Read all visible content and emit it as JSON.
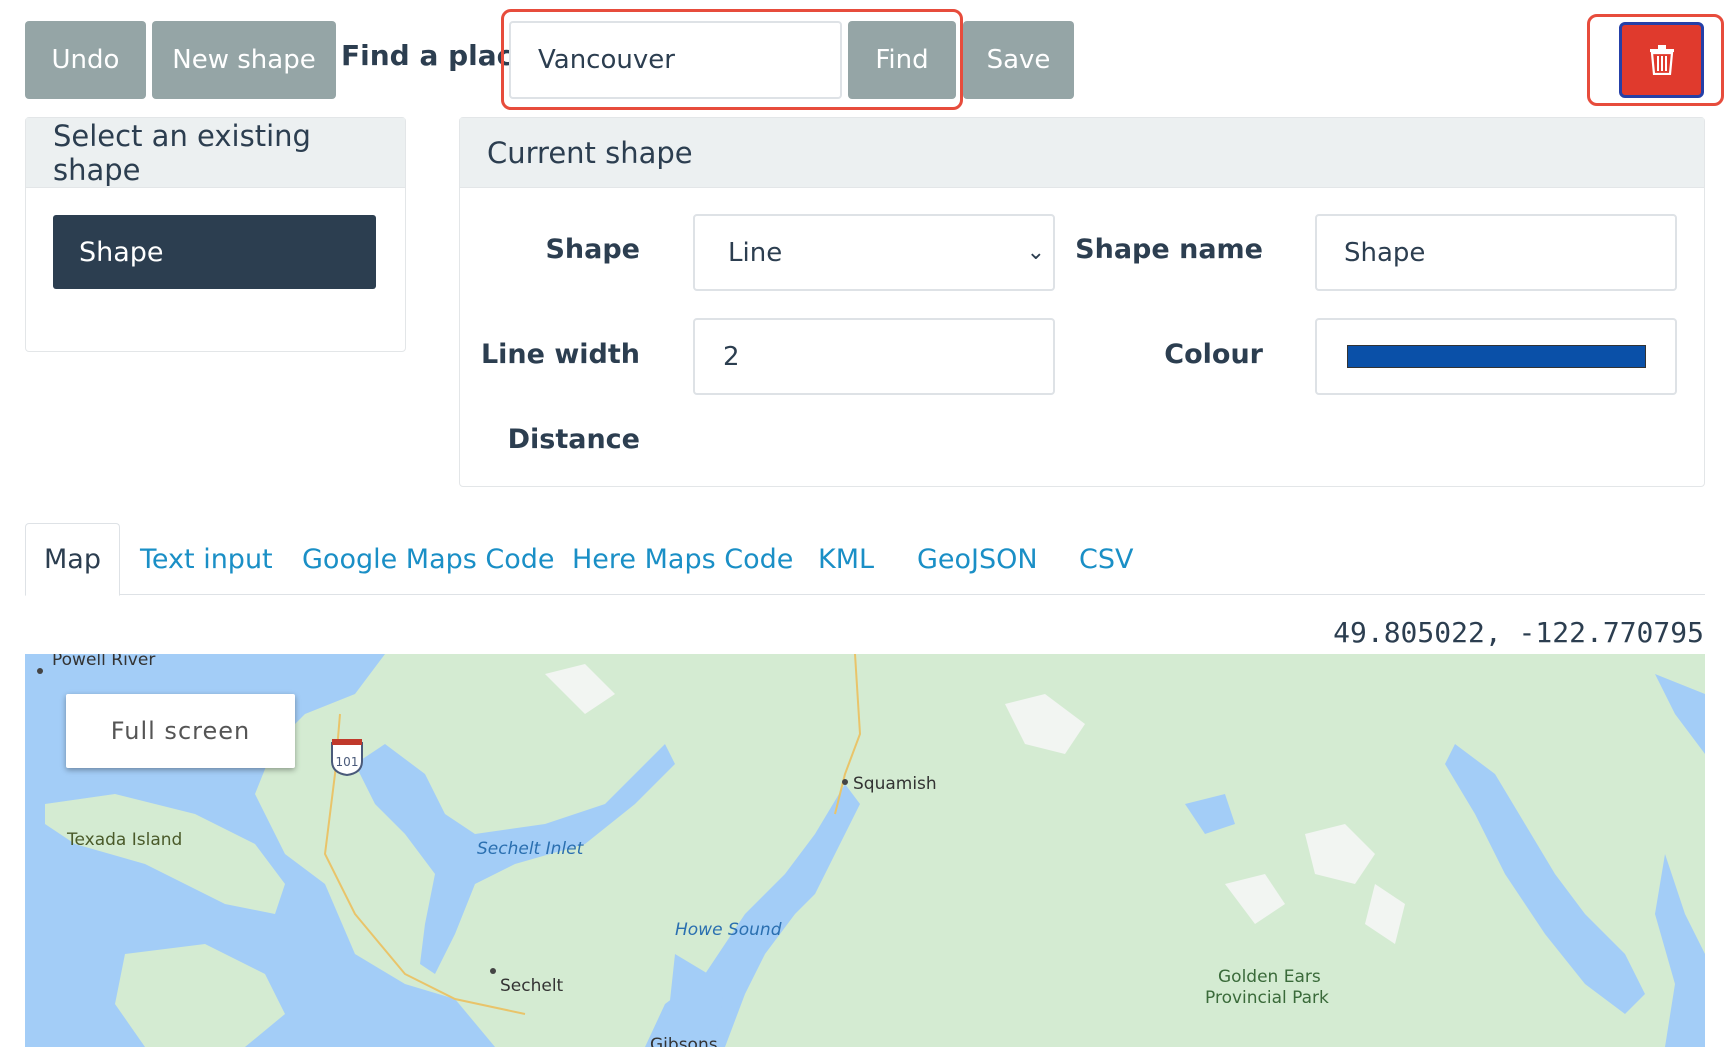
{
  "toolbar": {
    "undo_label": "Undo",
    "new_shape_label": "New shape",
    "find_label": "Find a place:",
    "find_value": "Vancouver",
    "find_button": "Find",
    "save_button": "Save"
  },
  "existing": {
    "header": "Select an existing shape",
    "items": [
      "Shape"
    ]
  },
  "current": {
    "header": "Current shape",
    "shape_label": "Shape",
    "shape_value": "Line",
    "shape_name_label": "Shape name",
    "shape_name_value": "Shape",
    "line_width_label": "Line width",
    "line_width_value": "2",
    "colour_label": "Colour",
    "colour_value": "#0a50a8",
    "distance_label": "Distance"
  },
  "tabs": [
    "Map",
    "Text input",
    "Google Maps Code",
    "Here Maps Code",
    "KML",
    "GeoJSON",
    "CSV"
  ],
  "coords": "49.805022, -122.770795",
  "map": {
    "fullscreen_label": "Full screen",
    "highway_shield": "101",
    "labels": {
      "powell_river": "Powell River",
      "texada": "Texada Island",
      "sechelt_inlet": "Sechelt Inlet",
      "squamish": "Squamish",
      "howe_sound": "Howe Sound",
      "sechelt": "Sechelt",
      "golden_ears_1": "Golden Ears",
      "golden_ears_2": "Provincial Park",
      "gibsons": "Gibsons"
    }
  }
}
